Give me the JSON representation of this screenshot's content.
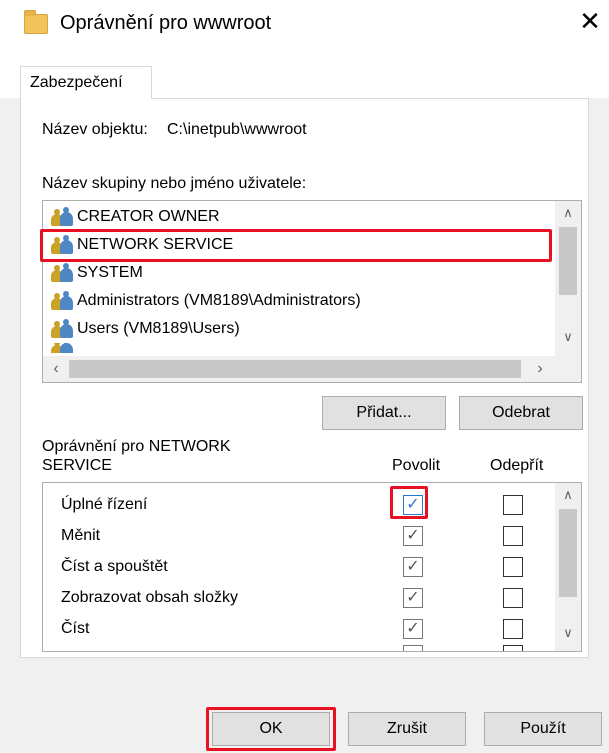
{
  "window": {
    "title": "Oprávnění pro wwwroot",
    "close_glyph": "✕"
  },
  "tab": {
    "label": "Zabezpečení"
  },
  "object": {
    "label": "Název objektu:",
    "path": "C:\\inetpub\\wwwroot"
  },
  "groups": {
    "label": "Název skupiny nebo jméno uživatele:",
    "items": [
      {
        "label": "CREATOR OWNER"
      },
      {
        "label": "NETWORK SERVICE"
      },
      {
        "label": "SYSTEM"
      },
      {
        "label": "Administrators (VM8189\\Administrators)"
      },
      {
        "label": "Users (VM8189\\Users)"
      }
    ],
    "selected": "NETWORK SERVICE"
  },
  "buttons": {
    "add": "Přidat...",
    "remove": "Odebrat",
    "ok": "OK",
    "cancel": "Zrušit",
    "apply": "Použít"
  },
  "permissions": {
    "label_line1": "Oprávnění pro NETWORK",
    "label_line2": "SERVICE",
    "allow_header": "Povolit",
    "deny_header": "Odepřít",
    "rows": [
      {
        "label": "Úplné řízení",
        "allow": true,
        "deny": false
      },
      {
        "label": "Měnit",
        "allow": true,
        "deny": false
      },
      {
        "label": "Číst a spouštět",
        "allow": true,
        "deny": false
      },
      {
        "label": "Zobrazovat obsah složky",
        "allow": true,
        "deny": false
      },
      {
        "label": "Číst",
        "allow": true,
        "deny": false
      }
    ]
  },
  "colors": {
    "highlight": "#e81123",
    "accent": "#2b79d0"
  }
}
